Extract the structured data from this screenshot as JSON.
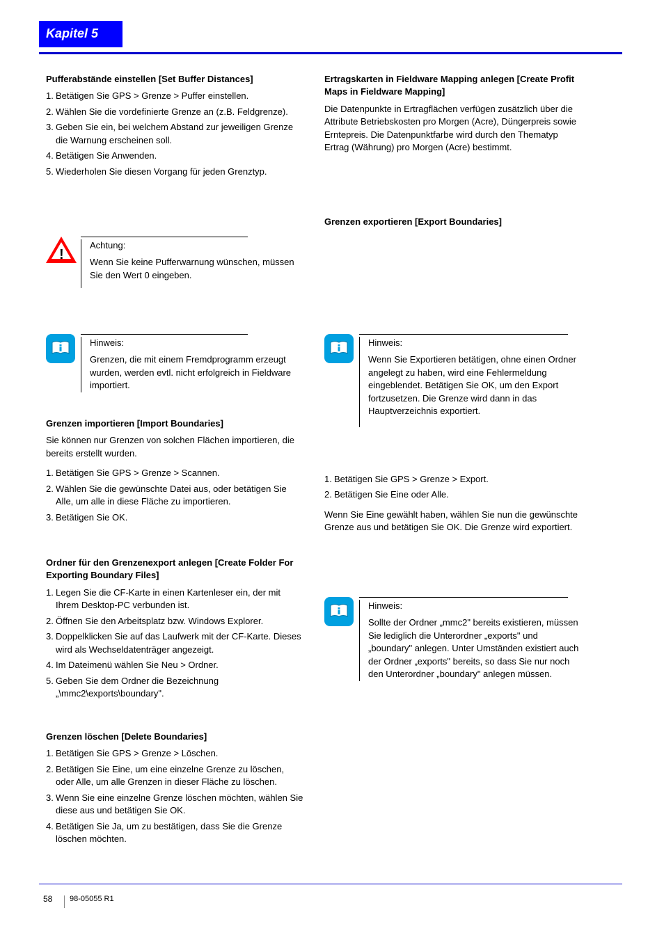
{
  "header": {
    "chapter_label": "Kapitel 5"
  },
  "sections": {
    "set_buffers": {
      "title": "Pufferabstände einstellen [Set Buffer Distances]",
      "items": [
        "Betätigen Sie GPS > Grenze > Puffer einstellen.",
        "Wählen Sie die vordefinierte Grenze an (z.B. Feldgrenze).",
        "Geben Sie ein, bei welchem Abstand zur jeweiligen Grenze die Warnung erscheinen soll.",
        "Betätigen Sie Anwenden.",
        "Wiederholen Sie diesen Vorgang für jeden Grenztyp."
      ],
      "note": {
        "heading": "Achtung:",
        "body": "Wenn Sie keine Pufferwarnung wünschen, müssen Sie den Wert 0 eingeben."
      }
    },
    "import_boundaries": {
      "title": "Grenzen importieren [Import Boundaries]",
      "intro": "Sie können nur Grenzen von solchen Flächen importieren, die bereits erstellt wurden.",
      "items": [
        "Betätigen Sie GPS > Grenze > Scannen.",
        "Wählen Sie die gewünschte Datei aus, oder betätigen Sie Alle, um alle in diese Fläche zu importieren.",
        "Betätigen Sie OK."
      ],
      "note": {
        "heading": "Hinweis:",
        "body": "Grenzen, die mit einem Fremdprogramm erzeugt wurden, werden evtl. nicht erfolgreich in Fieldware importiert."
      }
    },
    "export_boundaries": {
      "title": "Grenzen exportieren [Export Boundaries]",
      "note": {
        "heading": "Hinweis:",
        "body": "Wenn Sie Exportieren betätigen, ohne einen Ordner angelegt zu haben, wird eine Fehlermeldung eingeblendet. Betätigen Sie OK, um den Export fortzusetzen. Die Grenze wird dann in das Hauptverzeichnis exportiert."
      },
      "items": [
        "Betätigen Sie GPS > Grenze > Export.",
        "Betätigen Sie Eine oder Alle."
      ],
      "post": "Wenn Sie Eine gewählt haben, wählen Sie nun die gewünschte Grenze aus und betätigen Sie OK. Die Grenze wird exportiert."
    },
    "create_folder": {
      "title": "Ordner für den Grenzenexport anlegen [Create Folder For Exporting Boundary Files]",
      "items": [
        "Legen Sie die CF-Karte in einen Kartenleser ein, der mit Ihrem Desktop-PC verbunden ist.",
        "Öffnen Sie den Arbeitsplatz bzw. Windows Explorer.",
        "Doppelklicken Sie auf das Laufwerk mit der CF-Karte. Dieses wird als Wechseldatenträger angezeigt.",
        "Im Dateimenü wählen Sie Neu > Ordner.",
        "Geben Sie dem Ordner die Bezeichnung „\\mmc2\\exports\\boundary\"."
      ],
      "note": {
        "heading": "Hinweis:",
        "body": "Sollte der Ordner „mmc2\" bereits existieren, müssen Sie lediglich die Unterordner „exports\" und „boundary\" anlegen. Unter Umständen existiert auch der Ordner „exports\" bereits, so dass Sie nur noch den Unterordner „boundary\" anlegen müssen."
      }
    },
    "delete_boundaries": {
      "title": "Grenzen löschen [Delete Boundaries]",
      "items": [
        "Betätigen Sie GPS > Grenze > Löschen.",
        "Betätigen Sie Eine, um eine einzelne Grenze zu löschen, oder Alle, um alle Grenzen in dieser Fläche zu löschen.",
        "Wenn Sie eine einzelne Grenze löschen möchten, wählen Sie diese aus und betätigen Sie OK.",
        "Betätigen Sie Ja, um zu bestätigen, dass Sie die Grenze löschen möchten."
      ]
    },
    "create_profitmaps": {
      "title": "Ertragskarten in Fieldware Mapping anlegen [Create Profit Maps in Fieldware Mapping]",
      "intro": "Die Datenpunkte in Ertragflächen verfügen zusätzlich über die Attribute Betriebskosten pro Morgen (Acre), Düngerpreis sowie Erntepreis. Die Datenpunktfarbe wird durch den Thematyp Ertrag (Währung) pro Morgen (Acre) bestimmt."
    }
  },
  "footer": {
    "page_number": "58",
    "doc_id": "98-05055 R1"
  },
  "icons": {
    "warning": "warning-triangle-icon",
    "note": "book-info-icon"
  }
}
